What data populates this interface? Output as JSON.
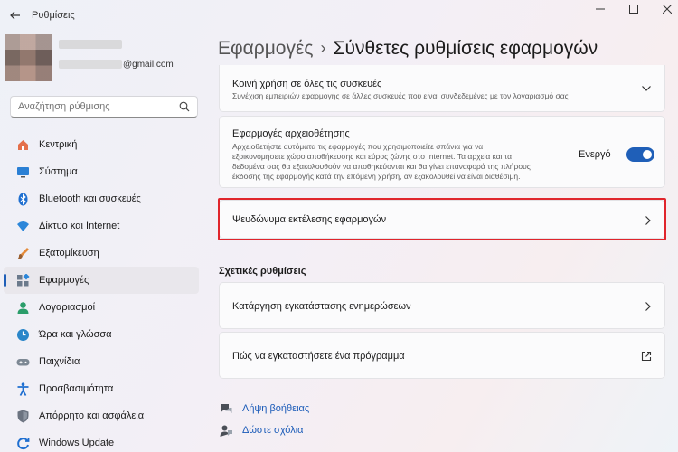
{
  "window": {
    "title": "Ρυθμίσεις",
    "controls": [
      "minimize-icon",
      "maximize-icon",
      "close-icon"
    ]
  },
  "profile": {
    "email_suffix": "@gmail.com"
  },
  "search": {
    "placeholder": "Αναζήτηση ρύθμισης"
  },
  "sidebar": {
    "items": [
      {
        "label": "Κεντρική",
        "icon": "home-icon"
      },
      {
        "label": "Σύστημα",
        "icon": "system-icon"
      },
      {
        "label": "Bluetooth και συσκευές",
        "icon": "bluetooth-icon"
      },
      {
        "label": "Δίκτυο και Internet",
        "icon": "wifi-icon"
      },
      {
        "label": "Εξατομίκευση",
        "icon": "brush-icon"
      },
      {
        "label": "Εφαρμογές",
        "icon": "apps-icon",
        "active": true
      },
      {
        "label": "Λογαριασμοί",
        "icon": "account-icon"
      },
      {
        "label": "Ώρα και γλώσσα",
        "icon": "time-language-icon"
      },
      {
        "label": "Παιχνίδια",
        "icon": "gamepad-icon"
      },
      {
        "label": "Προσβασιμότητα",
        "icon": "accessibility-icon"
      },
      {
        "label": "Απόρρητο και ασφάλεια",
        "icon": "shield-icon"
      },
      {
        "label": "Windows Update",
        "icon": "update-icon"
      }
    ]
  },
  "breadcrumb": {
    "parent": "Εφαρμογές",
    "separator": "›",
    "current": "Σύνθετες ρυθμίσεις εφαρμογών"
  },
  "cards": {
    "share": {
      "title": "Κοινή χρήση σε όλες τις συσκευές",
      "desc": "Συνέχιση εμπειριών εφαρμογής σε άλλες συσκευές που είναι συνδεδεμένες με τον λογαριασμό σας"
    },
    "archive": {
      "title": "Εφαρμογές αρχειοθέτησης",
      "desc": [
        "Αρχειοθετήστε αυτόματα τις εφαρμογές που χρησιμοποιείτε σπάνια για να",
        "εξοικονομήσετε χώρο αποθήκευσης και εύρος ζώνης στο Internet. Τα αρχεία και τα",
        "δεδομένα σας θα εξακολουθούν να αποθηκεύονται και θα γίνει επαναφορά της πλήρους",
        "έκδοσης της εφαρμογής κατά την επόμενη χρήση, αν εξακολουθεί να είναι διαθέσιμη."
      ],
      "toggle_label": "Ενεργό",
      "toggle_on": true
    },
    "alias": {
      "title": "Ψευδώνυμα εκτέλεσης εφαρμογών"
    }
  },
  "related": {
    "heading": "Σχετικές ρυθμίσεις",
    "items": [
      {
        "label": "Κατάργηση εγκατάστασης ενημερώσεων",
        "icon": "chevron-right-icon"
      },
      {
        "label": "Πώς να εγκαταστήσετε ένα πρόγραμμα",
        "icon": "external-link-icon"
      }
    ]
  },
  "footer": {
    "help": "Λήψη βοήθειας",
    "feedback": "Δώστε σχόλια"
  },
  "colors": {
    "accent": "#1f5fb8",
    "highlight": "#e0252c"
  }
}
